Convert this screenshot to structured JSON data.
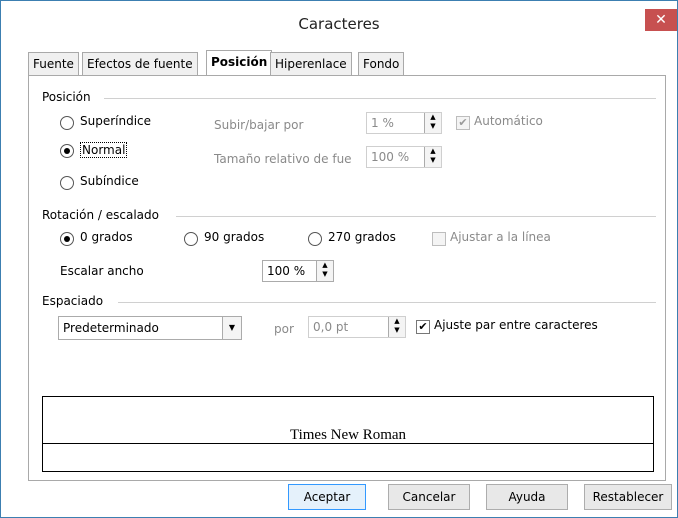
{
  "window": {
    "title": "Caracteres"
  },
  "tabs": [
    {
      "label": "Fuente",
      "active": false
    },
    {
      "label": "Efectos de fuente",
      "active": false
    },
    {
      "label": "Posición",
      "active": true
    },
    {
      "label": "Hiperenlace",
      "active": false
    },
    {
      "label": "Fondo",
      "active": false
    }
  ],
  "position": {
    "header": "Posición",
    "options": [
      {
        "label": "Superíndice",
        "selected": false
      },
      {
        "label": "Normal",
        "selected": true
      },
      {
        "label": "Subíndice",
        "selected": false
      }
    ],
    "raise_lower_label": "Subir/bajar por",
    "raise_lower_value": "1 %",
    "relative_size_label": "Tamaño relativo de fue",
    "relative_size_value": "100 %",
    "automatic_label": "Automático",
    "automatic_checked": true
  },
  "rotation": {
    "header": "Rotación / escalado",
    "options": [
      {
        "label": "0 grados",
        "selected": true
      },
      {
        "label": "90 grados",
        "selected": false
      },
      {
        "label": "270 grados",
        "selected": false
      }
    ],
    "fit_line_label": "Ajustar a la línea",
    "scale_width_label": "Escalar ancho",
    "scale_width_value": "100 %"
  },
  "spacing": {
    "header": "Espaciado",
    "select_value": "Predeterminado",
    "by_label": "por",
    "by_value": "0,0 pt",
    "kerning_label": "Ajuste par entre caracteres",
    "kerning_checked": true
  },
  "preview": {
    "text": "Times New Roman"
  },
  "buttons": {
    "ok": "Aceptar",
    "cancel": "Cancelar",
    "help": "Ayuda",
    "reset": "Restablecer"
  }
}
